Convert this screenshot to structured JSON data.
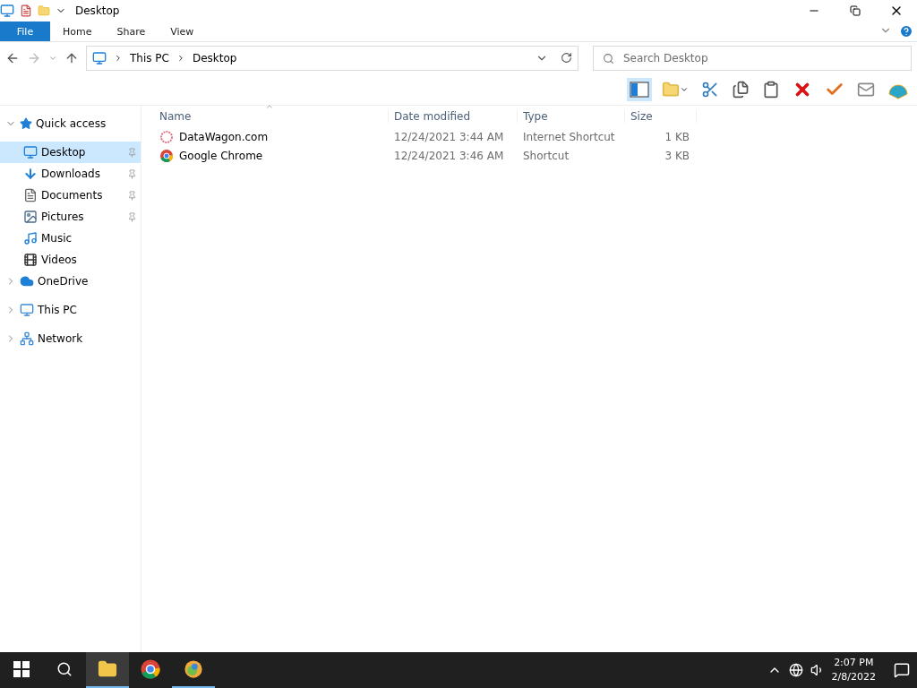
{
  "title_bar": {
    "title": "Desktop"
  },
  "ribbon": {
    "tabs": [
      {
        "label": "File",
        "kind": "file"
      },
      {
        "label": "Home",
        "kind": "tab"
      },
      {
        "label": "Share",
        "kind": "tab"
      },
      {
        "label": "View",
        "kind": "tab"
      }
    ]
  },
  "address_bar": {
    "path": [
      "This PC",
      "Desktop"
    ]
  },
  "search": {
    "placeholder": "Search Desktop"
  },
  "sidebar": {
    "items": [
      {
        "label": "Quick access",
        "kind": "star",
        "expanded": true,
        "children": [
          {
            "label": "Desktop",
            "kind": "desktop",
            "selected": true,
            "pinned": true
          },
          {
            "label": "Downloads",
            "kind": "download",
            "selected": false,
            "pinned": true
          },
          {
            "label": "Documents",
            "kind": "document",
            "selected": false,
            "pinned": true
          },
          {
            "label": "Pictures",
            "kind": "picture",
            "selected": false,
            "pinned": true
          },
          {
            "label": "Music",
            "kind": "music",
            "selected": false,
            "pinned": false
          },
          {
            "label": "Videos",
            "kind": "video",
            "selected": false,
            "pinned": false
          }
        ]
      },
      {
        "label": "OneDrive",
        "kind": "cloud",
        "expanded": false
      },
      {
        "label": "This PC",
        "kind": "pc",
        "expanded": false
      },
      {
        "label": "Network",
        "kind": "network",
        "expanded": false
      }
    ]
  },
  "table": {
    "columns": [
      "Name",
      "Date modified",
      "Type",
      "Size"
    ],
    "rows": [
      {
        "kind": "web",
        "name": "DataWagon.com",
        "date": "12/24/2021 3:44 AM",
        "type": "Internet Shortcut",
        "size": "1 KB"
      },
      {
        "kind": "chrome",
        "name": "Google Chrome",
        "date": "12/24/2021 3:46 AM",
        "type": "Shortcut",
        "size": "3 KB"
      }
    ]
  },
  "taskbar": {
    "apps": [
      {
        "kind": "explorer",
        "selected": true,
        "running": true
      },
      {
        "kind": "chrome",
        "selected": false,
        "running": false
      },
      {
        "kind": "globe",
        "selected": false,
        "running": true
      }
    ],
    "time": "2:07 PM",
    "date": "2/8/2022"
  }
}
